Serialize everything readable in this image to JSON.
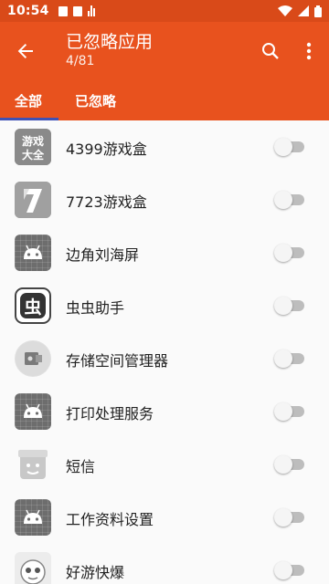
{
  "status_bar": {
    "time": "10:54"
  },
  "app_bar": {
    "title": "已忽略应用",
    "subtitle": "4/81"
  },
  "tabs": [
    {
      "label": "全部"
    },
    {
      "label": "已忽略"
    }
  ],
  "apps": [
    {
      "name": "4399游戏盒",
      "icon": "game-box-4399-icon",
      "enabled": false
    },
    {
      "name": "7723游戏盒",
      "icon": "game-box-7723-icon",
      "enabled": false
    },
    {
      "name": "边角刘海屏",
      "icon": "android-icon",
      "enabled": false
    },
    {
      "name": "虫虫助手",
      "icon": "chongchong-icon",
      "enabled": false
    },
    {
      "name": "存储空间管理器",
      "icon": "storage-icon",
      "enabled": false
    },
    {
      "name": "打印处理服务",
      "icon": "android-icon",
      "enabled": false
    },
    {
      "name": "短信",
      "icon": "sms-robot-icon",
      "enabled": false
    },
    {
      "name": "工作资料设置",
      "icon": "android-icon",
      "enabled": false
    },
    {
      "name": "好游快爆",
      "icon": "haoyou-icon",
      "enabled": false
    }
  ],
  "colors": {
    "primary": "#e8521e",
    "status_bar": "#d94a19",
    "indicator": "#3f51b5"
  }
}
